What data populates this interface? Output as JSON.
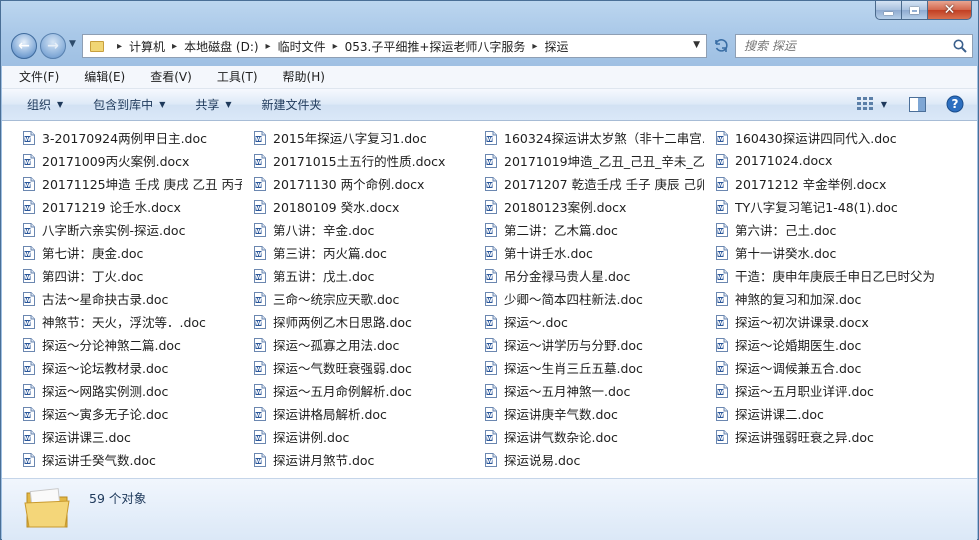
{
  "window": {
    "controls": {
      "minimize_icon": "minimize-icon",
      "maximize_icon": "maximize-icon",
      "close_icon": "close-icon"
    }
  },
  "navigation": {
    "back_icon": "back-arrow-icon",
    "forward_icon": "forward-arrow-icon",
    "breadcrumbs": [
      "计算机",
      "本地磁盘 (D:)",
      "临时文件",
      "053.子平细推+探运老师八字服务",
      "探运"
    ],
    "search_placeholder": "搜索 探运"
  },
  "menu": [
    "文件(F)",
    "编辑(E)",
    "查看(V)",
    "工具(T)",
    "帮助(H)"
  ],
  "toolbar": {
    "organize": "组织",
    "include_library": "包含到库中",
    "share": "共享",
    "new_folder": "新建文件夹"
  },
  "files": [
    "3-20170924两例甲日主.doc",
    "2015年探运八字复习1.doc",
    "160324探运讲太岁煞（非十二串宫...",
    "160430探运讲四同代入.doc",
    "20171009丙火案例.docx",
    "20171015土五行的性质.docx",
    "20171019坤造_乙丑_己丑_辛未_乙...",
    "20171024.docx",
    "20171125坤造 壬戌 庚戌 乙丑 丙子...",
    "20171130 两个命例.docx",
    "20171207 乾造壬戌 壬子 庚辰 己卯...",
    "20171212  辛金举例.docx",
    "20171219 论壬水.docx",
    "20180109 癸水.docx",
    "20180123案例.docx",
    "TY八字复习笔记1-48(1).doc",
    "八字断六亲实例-探运.doc",
    "第八讲：辛金.doc",
    "第二讲：乙木篇.doc",
    "第六讲：己土.doc",
    "第七讲：庚金.doc",
    "第三讲：丙火篇.doc",
    "第十讲壬水.doc",
    "第十一讲癸水.doc",
    "第四讲：丁火.doc",
    "第五讲：戊土.doc",
    "吊分金禄马贵人星.doc",
    "干造：庚申年庚辰壬申日乙巳时父为...",
    "古法～星命抉古录.doc",
    "三命～统宗应天歌.doc",
    "少卿～简本四柱新法.doc",
    "神煞的复习和加深.doc",
    "神煞节：天火，浮沈等．.doc",
    "探师两例乙木日思路.doc",
    "探运～.doc",
    "探运～初次讲课录.docx",
    "探运～分论神煞二篇.doc",
    "探运～孤寡之用法.doc",
    "探运～讲学历与分野.doc",
    "探运～论婚期医生.doc",
    "探运～论坛教材录.doc",
    "探运～气数旺衰强弱.doc",
    "探运～生肖三丘五墓.doc",
    "探运～调候兼五合.doc",
    "探运～网路实例测.doc",
    "探运～五月命例解析.doc",
    "探运～五月神煞一.doc",
    "探运～五月职业详评.doc",
    "探运～寅多无子论.doc",
    "探运讲格局解析.doc",
    "探运讲庚辛气数.doc",
    "探运讲课二.doc",
    "探运讲课三.doc",
    "探运讲例.doc",
    "探运讲气数杂论.doc",
    "探运讲强弱旺衰之异.doc",
    "探运讲壬癸气数.doc",
    "探运讲月煞节.doc",
    "探运说易.doc"
  ],
  "status": {
    "count": "59 个对象"
  },
  "colors": {
    "accent": "#2b579a",
    "chrome": "#a9c8e8",
    "folder": "#f1d675"
  }
}
